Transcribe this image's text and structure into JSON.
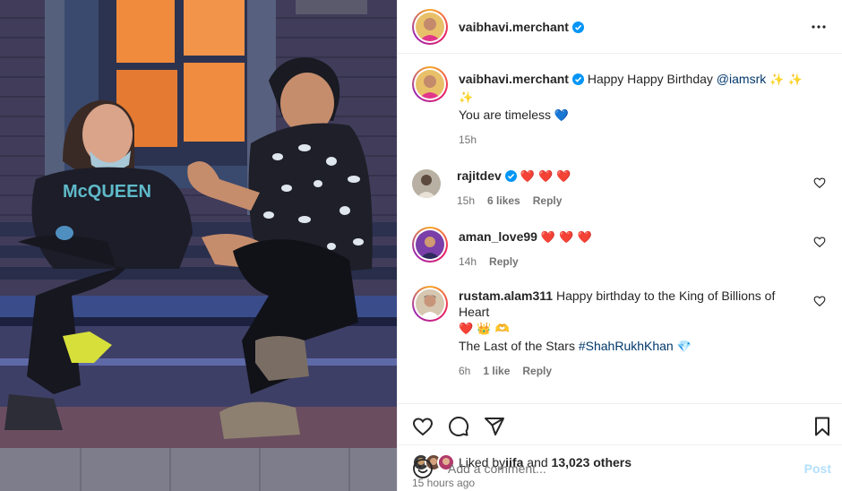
{
  "post": {
    "author": "vaibhavi.merchant",
    "more_icon": "more-horizontal-icon",
    "caption": {
      "username": "vaibhavi.merchant",
      "text_before": "Happy Happy Birthday ",
      "mention": "@iamsrk",
      "sparkles": "✨ ✨ ✨",
      "line2": "You are timeless",
      "line2_emoji": "💙",
      "time": "15h"
    },
    "comments": [
      {
        "username": "rajitdev",
        "verified": true,
        "text": "❤️ ❤️ ❤️",
        "time": "15h",
        "likes": "6 likes",
        "reply": "Reply"
      },
      {
        "username": "aman_love99",
        "verified": false,
        "text": "❤️ ❤️ ❤️",
        "time": "14h",
        "likes": "",
        "reply": "Reply"
      },
      {
        "username": "rustam.alam311",
        "verified": false,
        "text": "Happy birthday to the King of Billions of Heart",
        "text_emoji": "❤️ 👑 🫶",
        "line2": "The Last of the Stars ",
        "hashtag": "#ShahRukhKhan",
        "line2_emoji": "💎",
        "time": "6h",
        "likes": "1 like",
        "reply": "Reply"
      }
    ],
    "actions": {
      "like_icon": "heart-icon",
      "comment_icon": "comment-icon",
      "share_icon": "send-icon",
      "save_icon": "bookmark-icon"
    },
    "likes": {
      "prefix": "Liked by ",
      "user": "iifa",
      "middle": " and ",
      "count": "13,023 others"
    },
    "posted": "15 hours ago",
    "add_comment": {
      "placeholder": "Add a comment...",
      "post_label": "Post",
      "emoji_icon": "smile-icon"
    }
  },
  "colors": {
    "verified": "#0095f6",
    "link": "#00376b",
    "muted": "#737373",
    "post_disabled": "#b2dffc",
    "heart_red": "#ed2b5a"
  }
}
